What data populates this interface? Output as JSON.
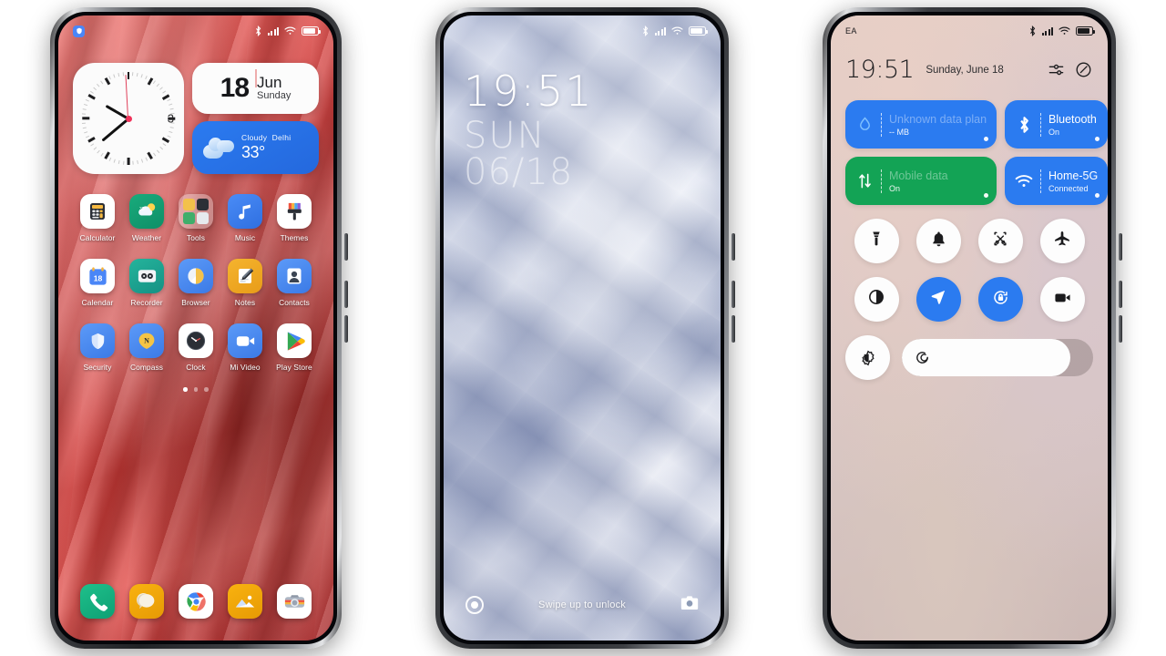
{
  "colors": {
    "accent_blue": "#2b7bf0",
    "accent_green": "#13a355",
    "home_wallpaper": "#d6403f",
    "lock_wallpaper": "#b8c1da",
    "cc_wallpaper": "#dcc8c8",
    "second_hand": "#e0405a"
  },
  "home": {
    "status": {
      "notification_icon": "security-shield-icon",
      "bluetooth_icon": "bluetooth-icon",
      "signal_icon": "signal-bars-icon",
      "wifi_icon": "wifi-icon",
      "battery_icon": "battery-icon"
    },
    "clock_widget": {
      "name": "analog-clock-widget",
      "hour_label": "3",
      "hour_angle": -60,
      "minute_angle": 230,
      "second_angle": 357
    },
    "date_widget": {
      "day": "18",
      "month": "Jun",
      "weekday": "Sunday"
    },
    "weather_widget": {
      "condition": "Cloudy",
      "city": "Delhi",
      "temperature": "33°",
      "icon": "cloud-icon"
    },
    "apps": [
      {
        "label": "Calculator",
        "icon": "calculator-icon"
      },
      {
        "label": "Weather",
        "icon": "weather-icon"
      },
      {
        "label": "Tools",
        "icon": "tools-folder-icon"
      },
      {
        "label": "Music",
        "icon": "music-note-icon"
      },
      {
        "label": "Themes",
        "icon": "themes-brush-icon"
      },
      {
        "label": "Calendar",
        "icon": "calendar-icon"
      },
      {
        "label": "Recorder",
        "icon": "recorder-icon"
      },
      {
        "label": "Browser",
        "icon": "browser-icon"
      },
      {
        "label": "Notes",
        "icon": "notes-pen-icon"
      },
      {
        "label": "Contacts",
        "icon": "contacts-person-icon"
      },
      {
        "label": "Security",
        "icon": "security-shield-icon"
      },
      {
        "label": "Compass",
        "icon": "compass-icon"
      },
      {
        "label": "Clock",
        "icon": "clock-icon"
      },
      {
        "label": "Mi Video",
        "icon": "video-camera-icon"
      },
      {
        "label": "Play Store",
        "icon": "play-store-icon"
      }
    ],
    "page_dots": {
      "count": 3,
      "active_index": 0
    },
    "dock": [
      {
        "name": "phone-app",
        "icon": "phone-handset-icon"
      },
      {
        "name": "messages-app",
        "icon": "messages-bubble-icon"
      },
      {
        "name": "chrome-app",
        "icon": "chrome-icon"
      },
      {
        "name": "gallery-app",
        "icon": "gallery-photo-icon"
      },
      {
        "name": "camera-app",
        "icon": "camera-icon"
      }
    ]
  },
  "lock": {
    "time": "19:51",
    "weekday": "SUN",
    "date": "06/18",
    "hint": "Swipe up to unlock",
    "left_icon": "flashlight-circle-icon",
    "right_icon": "camera-icon"
  },
  "control_center": {
    "carrier": "EA",
    "time": "19:51",
    "date": "Sunday, June 18",
    "header_icons": [
      {
        "name": "settings-sliders-icon"
      },
      {
        "name": "edit-toggles-icon"
      }
    ],
    "tiles": [
      {
        "name": "data-usage-tile",
        "title": "Unknown data plan",
        "subtitle": "-- MB",
        "state": "blue",
        "icon": "data-drop-icon",
        "faded": true
      },
      {
        "name": "bluetooth-tile",
        "title": "Bluetooth",
        "subtitle": "On",
        "state": "blue",
        "icon": "bluetooth-icon",
        "faded": false
      },
      {
        "name": "mobile-data-tile",
        "title": "Mobile data",
        "subtitle": "On",
        "state": "green",
        "icon": "data-arrows-icon",
        "faded": true
      },
      {
        "name": "wifi-tile",
        "title": "Home-5G",
        "subtitle": "Connected",
        "state": "blue",
        "icon": "wifi-icon",
        "faded": false
      }
    ],
    "quick_toggles": [
      {
        "name": "flashlight-toggle",
        "icon": "flashlight-icon",
        "active": false
      },
      {
        "name": "silent-toggle",
        "icon": "bell-icon",
        "active": false
      },
      {
        "name": "screenshot-toggle",
        "icon": "screenshot-scissors-icon",
        "active": false
      },
      {
        "name": "airplane-mode-toggle",
        "icon": "airplane-icon",
        "active": false
      },
      {
        "name": "dark-mode-toggle",
        "icon": "dark-mode-contrast-icon",
        "active": false
      },
      {
        "name": "location-toggle",
        "icon": "location-arrow-icon",
        "active": true
      },
      {
        "name": "auto-rotate-toggle",
        "icon": "rotation-lock-icon",
        "active": true
      },
      {
        "name": "screen-recorder-toggle",
        "icon": "video-camera-icon",
        "active": false
      }
    ],
    "brightness": {
      "auto_icon": "brightness-auto-icon",
      "slider_icon": "brightness-ring-icon",
      "level": 88
    }
  }
}
